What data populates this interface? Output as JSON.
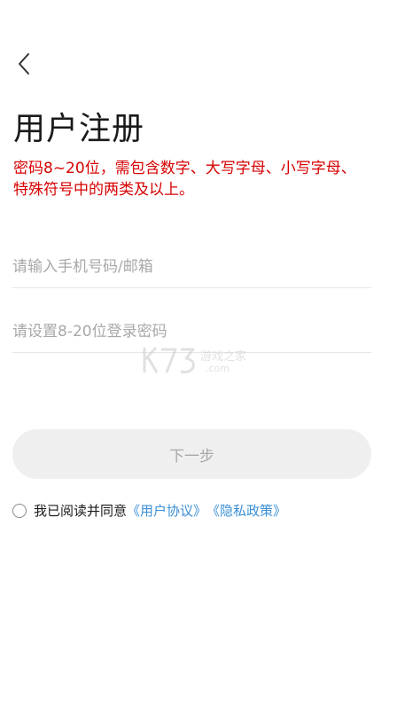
{
  "header": {
    "back_icon": "chevron-left-icon"
  },
  "title": "用户注册",
  "hint": "密码8~20位，需包含数字、大写字母、小写字母、特殊符号中的两类及以上。",
  "fields": {
    "account_placeholder": "请输入手机号码/邮箱",
    "password_placeholder": "请设置8-20位登录密码"
  },
  "next_button": "下一步",
  "agreement": {
    "prefix": "我已阅读并同意",
    "user_agreement": "《用户协议》",
    "privacy_policy": "《隐私政策》"
  },
  "colors": {
    "hint_red": "#d60000",
    "link_blue": "#3a8fd6",
    "button_disabled_bg": "#efefef"
  }
}
